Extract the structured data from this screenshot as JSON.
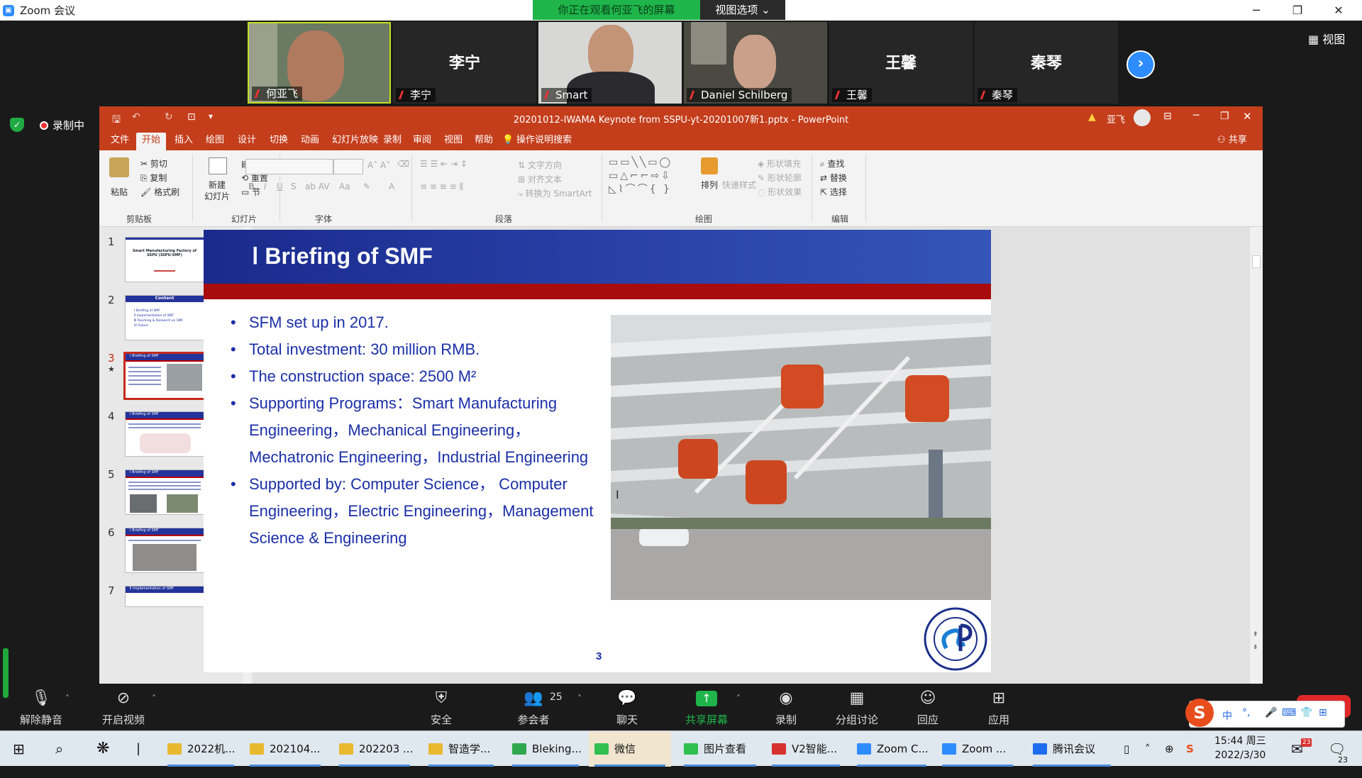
{
  "zoom": {
    "app_title": "Zoom 会议",
    "viewing_banner": "你正在观看何亚飞的屏幕",
    "view_options": "视图选项 ⌄",
    "view_button": "视图",
    "recording_label": "录制中",
    "participants": [
      {
        "name": "何亚飞",
        "video": true
      },
      {
        "name": "李宁",
        "video": false
      },
      {
        "name": "Smart",
        "video": true
      },
      {
        "name": "Daniel Schilberg",
        "video": true
      },
      {
        "name": "王馨",
        "video": false
      },
      {
        "name": "秦琴",
        "video": false
      }
    ],
    "toolbar": {
      "unmute": "解除静音",
      "start_video": "开启视频",
      "security": "安全",
      "participants": "参会者",
      "participants_count": "25",
      "chat": "聊天",
      "share_screen": "共享屏幕",
      "record": "录制",
      "breakout": "分组讨论",
      "reactions": "回应",
      "apps": "应用",
      "leave": "离开"
    }
  },
  "powerpoint": {
    "file_title": "20201012-IWAMA Keynote from SSPU-yt-20201007新1.pptx  -  PowerPoint",
    "user": "亚飞",
    "share": "共享",
    "tabs": [
      "文件",
      "开始",
      "插入",
      "绘图",
      "设计",
      "切换",
      "动画",
      "幻灯片放映",
      "录制",
      "审阅",
      "视图",
      "帮助",
      "操作说明搜索"
    ],
    "active_tab": "开始",
    "ribbon": {
      "paste": "粘贴",
      "cut": "剪切",
      "copy": "复制",
      "format_painter": "格式刷",
      "clipboard": "剪贴板",
      "new_slide": "新建",
      "new_slide2": "幻灯片",
      "layout": "版式",
      "reset": "重置",
      "section": "节",
      "slides_group": "幻灯片",
      "font_group": "字体",
      "text_direction": "文字方向",
      "align_text": "对齐文本",
      "smartart": "转换为 SmartArt",
      "paragraph_group": "段落",
      "arrange": "排列",
      "quick_styles": "快速样式",
      "shape_fill": "形状填充",
      "shape_outline": "形状轮廓",
      "shape_effects": "形状效果",
      "drawing_group": "绘图",
      "find": "查找",
      "replace": "替换",
      "select": "选择",
      "editing_group": "编辑"
    },
    "thumbnails": [
      {
        "num": "1",
        "title": "Smart Manufacturing Factory of SSPU (SSPU-SMF)"
      },
      {
        "num": "2",
        "title": "Content",
        "items": [
          "Ⅰ Briefing of SMF",
          "Ⅱ Implementation of SMF",
          "Ⅲ Teaching & Research on SMF",
          "Ⅳ Future"
        ]
      },
      {
        "num": "3",
        "title": "Ⅰ Briefing of SMF"
      },
      {
        "num": "4",
        "title": "Ⅰ Briefing of SMF"
      },
      {
        "num": "5",
        "title": "Ⅰ Briefing of SMF"
      },
      {
        "num": "6",
        "title": "Ⅰ Briefing of SMF"
      },
      {
        "num": "7",
        "title": "Ⅱ Implementation of SMF"
      }
    ],
    "selected_thumb_mark": "★",
    "slide": {
      "title": "Ⅰ  Briefing of SMF",
      "bullets": [
        "SFM set up in 2017.",
        "Total investment: 30 million RMB.",
        "The construction space: 2500 M²",
        "Supporting Programs：Smart Manufacturing Engineering，Mechanical Engineering，Mechatronic Engineering，Industrial Engineering",
        "Supported by: Computer Science， Computer Engineering，Electric Engineering，Management Science & Engineering"
      ],
      "page_number": "3",
      "logo_text": "Shanghai Polytechnic University"
    }
  },
  "taskbar": {
    "items": [
      {
        "label": "2022机...",
        "color": "#e8b92f"
      },
      {
        "label": "202104...",
        "color": "#e8b92f"
      },
      {
        "label": "202203 ...",
        "color": "#e8b92f"
      },
      {
        "label": "智造学...",
        "color": "#e8b92f"
      },
      {
        "label": "Bleking...",
        "color": "#2fa84f"
      },
      {
        "label": "微信",
        "color": "#2fc04f"
      },
      {
        "label": "图片查看",
        "color": "#2fc04f"
      },
      {
        "label": "V2智能...",
        "color": "#d8322e"
      },
      {
        "label": "Zoom C...",
        "color": "#2d8cff"
      },
      {
        "label": "Zoom ...",
        "color": "#2d8cff"
      },
      {
        "label": "腾讯会议",
        "color": "#1d6cf0"
      }
    ],
    "time": "15:44 周三",
    "date": "2022/3/30",
    "notif_count": "23",
    "mail_badge": "23",
    "ime_lang": "中"
  }
}
